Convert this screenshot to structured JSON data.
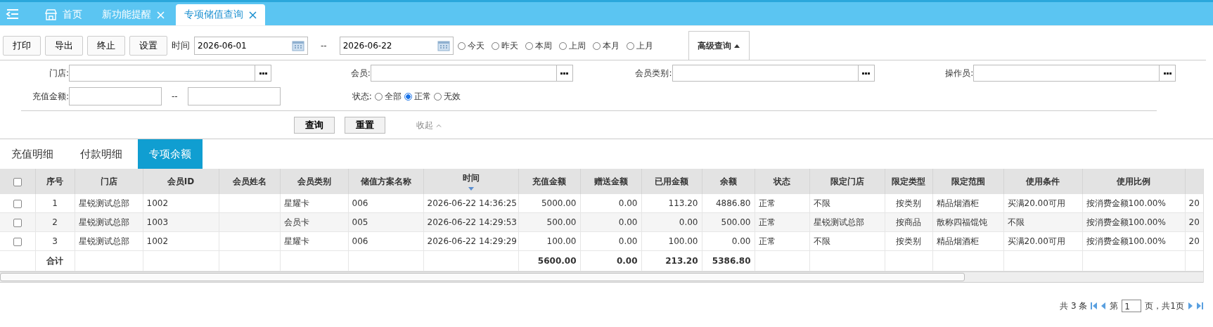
{
  "tabs": [
    {
      "label": "首页",
      "kind": "home",
      "selected": false,
      "closable": false
    },
    {
      "label": "新功能提醒",
      "kind": "plain",
      "selected": false,
      "closable": true
    },
    {
      "label": "专项储值查询",
      "kind": "plain",
      "selected": true,
      "closable": true
    }
  ],
  "toolbar": {
    "buttons": [
      "打印",
      "导出",
      "终止",
      "设置"
    ],
    "time_label": "时间",
    "date_from": "2026-06-01",
    "date_sep": "--",
    "date_to": "2026-06-22",
    "ranges": [
      {
        "label": "今天",
        "selected": false
      },
      {
        "label": "昨天",
        "selected": false
      },
      {
        "label": "本周",
        "selected": false
      },
      {
        "label": "上周",
        "selected": false
      },
      {
        "label": "本月",
        "selected": false
      },
      {
        "label": "上月",
        "selected": false
      }
    ],
    "advanced": "高级查询"
  },
  "filters": {
    "pickers": [
      {
        "label": "门店:"
      },
      {
        "label": "会员:"
      },
      {
        "label": "会员类别:"
      },
      {
        "label": "操作员:"
      }
    ],
    "amount_label": "充值金额:",
    "amount_sep": "--",
    "status_label": "状态:",
    "status": [
      {
        "label": "全部",
        "selected": false
      },
      {
        "label": "正常",
        "selected": true
      },
      {
        "label": "无效",
        "selected": false
      }
    ],
    "query": "查询",
    "reset": "重置",
    "collapse": "收起"
  },
  "sub_tabs": [
    {
      "label": "充值明细",
      "selected": false
    },
    {
      "label": "付款明细",
      "selected": false
    },
    {
      "label": "专项余额",
      "selected": true
    }
  ],
  "table": {
    "all_checked": false,
    "columns": [
      {
        "label": "序号",
        "sorted": false
      },
      {
        "label": "门店",
        "sorted": false
      },
      {
        "label": "会员ID",
        "sorted": false
      },
      {
        "label": "会员姓名",
        "sorted": false
      },
      {
        "label": "会员类别",
        "sorted": false
      },
      {
        "label": "储值方案名称",
        "sorted": false
      },
      {
        "label": "时间",
        "sorted": true
      },
      {
        "label": "充值金额",
        "sorted": false
      },
      {
        "label": "赠送金额",
        "sorted": false
      },
      {
        "label": "已用金额",
        "sorted": false
      },
      {
        "label": "余额",
        "sorted": false
      },
      {
        "label": "状态",
        "sorted": false
      },
      {
        "label": "限定门店",
        "sorted": false
      },
      {
        "label": "限定类型",
        "sorted": false
      },
      {
        "label": "限定范围",
        "sorted": false
      },
      {
        "label": "使用条件",
        "sorted": false
      },
      {
        "label": "使用比例",
        "sorted": false
      }
    ],
    "rows": [
      {
        "checked": false,
        "cells": [
          "1",
          "星锐测试总部",
          "1002",
          "",
          "星耀卡",
          "006",
          "2026-06-22 14:36:25",
          "5000.00",
          "0.00",
          "113.20",
          "4886.80",
          "正常",
          "不限",
          "按类别",
          "精品烟酒柜",
          "买满20.00可用",
          "按消费金额100.00%",
          "20"
        ]
      },
      {
        "checked": false,
        "cells": [
          "2",
          "星锐测试总部",
          "1003",
          "",
          "会员卡",
          "005",
          "2026-06-22 14:29:53",
          "500.00",
          "0.00",
          "0.00",
          "500.00",
          "正常",
          "星锐测试总部",
          "按商品",
          "散称四福馄饨",
          "不限",
          "按消费金额100.00%",
          "20"
        ]
      },
      {
        "checked": false,
        "cells": [
          "3",
          "星锐测试总部",
          "1002",
          "",
          "星耀卡",
          "006",
          "2026-06-22 14:29:29",
          "100.00",
          "0.00",
          "100.00",
          "0.00",
          "正常",
          "不限",
          "按类别",
          "精品烟酒柜",
          "买满20.00可用",
          "按消费金额100.00%",
          "20"
        ]
      }
    ],
    "totals_label": "合计",
    "totals": {
      "7": "5600.00",
      "8": "0.00",
      "9": "213.20",
      "10": "5386.80"
    }
  },
  "pager": {
    "total": "共 3 条",
    "page_prefix": "第",
    "page": "1",
    "page_suffix": "页，共1页"
  }
}
